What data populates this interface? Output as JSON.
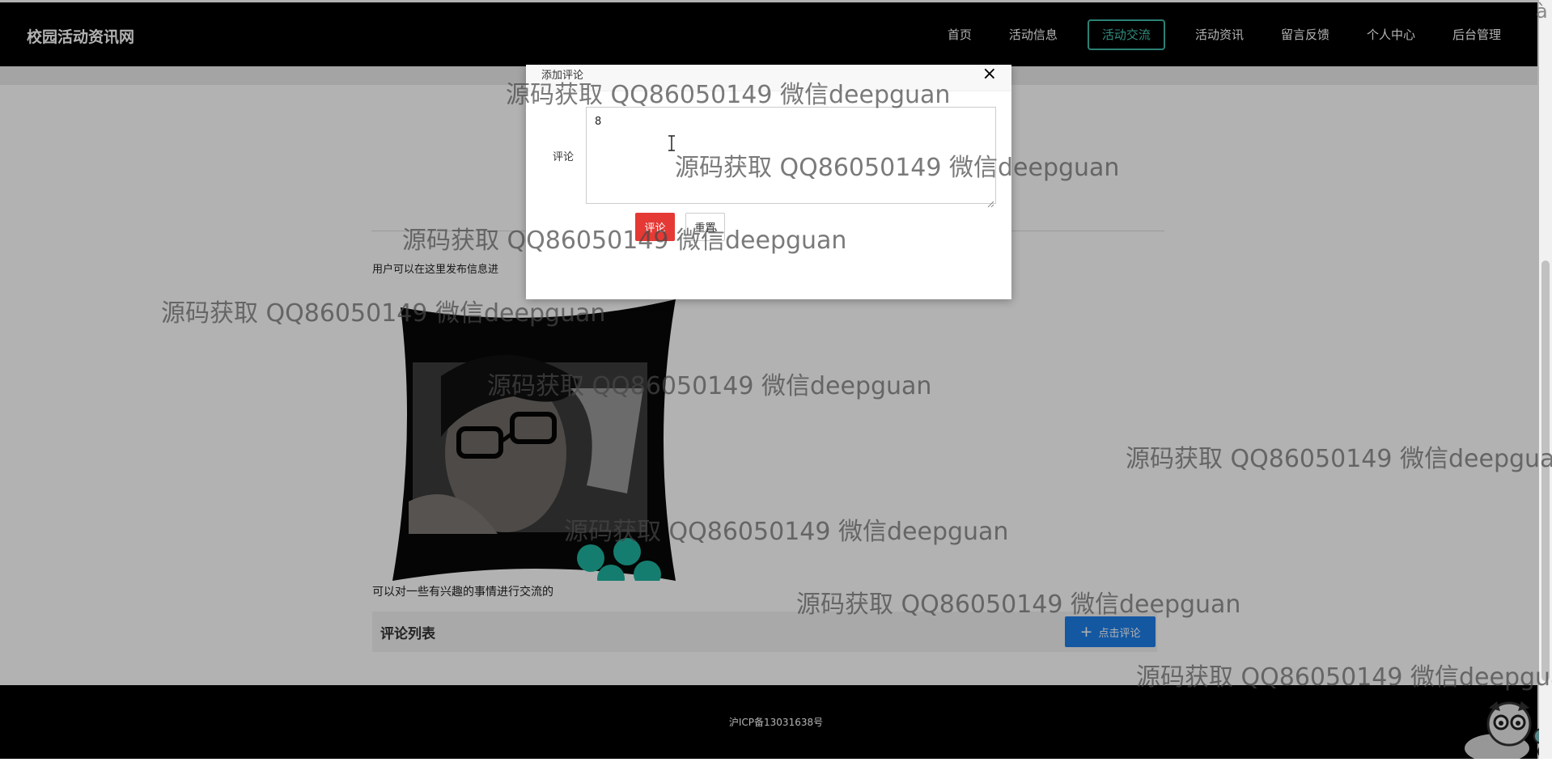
{
  "site": {
    "title": "校园活动资讯网"
  },
  "nav": {
    "items": [
      "首页",
      "活动信息",
      "活动交流",
      "活动资讯",
      "留言反馈",
      "个人中心",
      "后台管理"
    ],
    "active": "活动交流"
  },
  "content": {
    "intro": "用户可以在这里发布信息进",
    "description": "可以对一些有兴趣的事情进行交流的",
    "comment_list_title": "评论列表",
    "add_comment_button": "点击评论"
  },
  "modal": {
    "title": "添加评论",
    "close": "×",
    "field_label": "评论",
    "textarea_value": "8",
    "submit_label": "评论",
    "reset_label": "重置"
  },
  "footer": {
    "icp": "沪ICP备13031638号"
  },
  "watermark": {
    "text": "源码获取 QQ86050149 微信deepguan"
  },
  "corner_glyph": "à",
  "colors": {
    "nav_active": "#48c7b5",
    "comment_button": "#1e7fe8",
    "submit_button": "#e53935"
  }
}
